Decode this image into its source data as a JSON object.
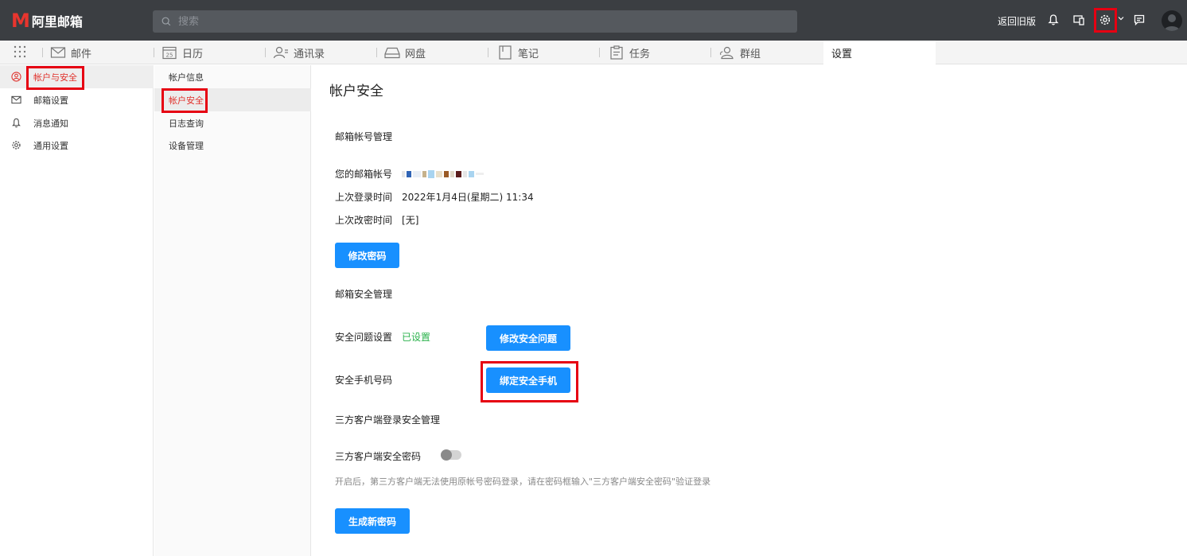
{
  "app": {
    "logo_mark": "M",
    "logo_text": "阿里邮箱",
    "search_placeholder": "搜索",
    "old_version": "返回旧版"
  },
  "tabs": [
    {
      "label": "邮件",
      "icon": "mail-icon"
    },
    {
      "label": "日历",
      "icon": "calendar-icon",
      "calendar_day": "25"
    },
    {
      "label": "通讯录",
      "icon": "contacts-icon"
    },
    {
      "label": "网盘",
      "icon": "drive-icon"
    },
    {
      "label": "笔记",
      "icon": "note-icon"
    },
    {
      "label": "任务",
      "icon": "task-icon"
    },
    {
      "label": "群组",
      "icon": "group-icon"
    },
    {
      "label": "设置"
    }
  ],
  "sidebar": {
    "items": [
      {
        "label": "帐户与安全",
        "icon": "user-circle-icon",
        "active": true
      },
      {
        "label": "邮箱设置",
        "icon": "mail-settings-icon"
      },
      {
        "label": "消息通知",
        "icon": "bell-icon"
      },
      {
        "label": "通用设置",
        "icon": "gear-icon"
      }
    ]
  },
  "submenu": {
    "items": [
      {
        "label": "帐户信息"
      },
      {
        "label": "帐户安全",
        "active": true
      },
      {
        "label": "日志查询"
      },
      {
        "label": "设备管理"
      }
    ]
  },
  "main": {
    "title": "帐户安全",
    "account_section": "邮箱帐号管理",
    "email_label": "您的邮箱帐号",
    "last_login_label": "上次登录时间",
    "last_login_value": "2022年1月4日(星期二) 11:34",
    "last_pwd_label": "上次改密时间",
    "last_pwd_value": "[无]",
    "change_password_btn": "修改密码",
    "security_section": "邮箱安全管理",
    "question_label": "安全问题设置",
    "question_status": "已设置",
    "change_question_btn": "修改安全问题",
    "phone_label": "安全手机号码",
    "bind_phone_btn": "绑定安全手机",
    "thirdparty_section": "三方客户端登录安全管理",
    "thirdparty_label": "三方客户端安全密码",
    "thirdparty_hint": "开启后，第三方客户端无法使用原帐号密码登录，请在密码框输入\"三方客户端安全密码\"验证登录",
    "generate_btn": "生成新密码"
  },
  "colors": {
    "topbar": "#3b3e42",
    "accent_button": "#1890ff",
    "active_text": "#e0312b",
    "status_ok": "#2ab24b",
    "highlight_box": "#e60012"
  }
}
